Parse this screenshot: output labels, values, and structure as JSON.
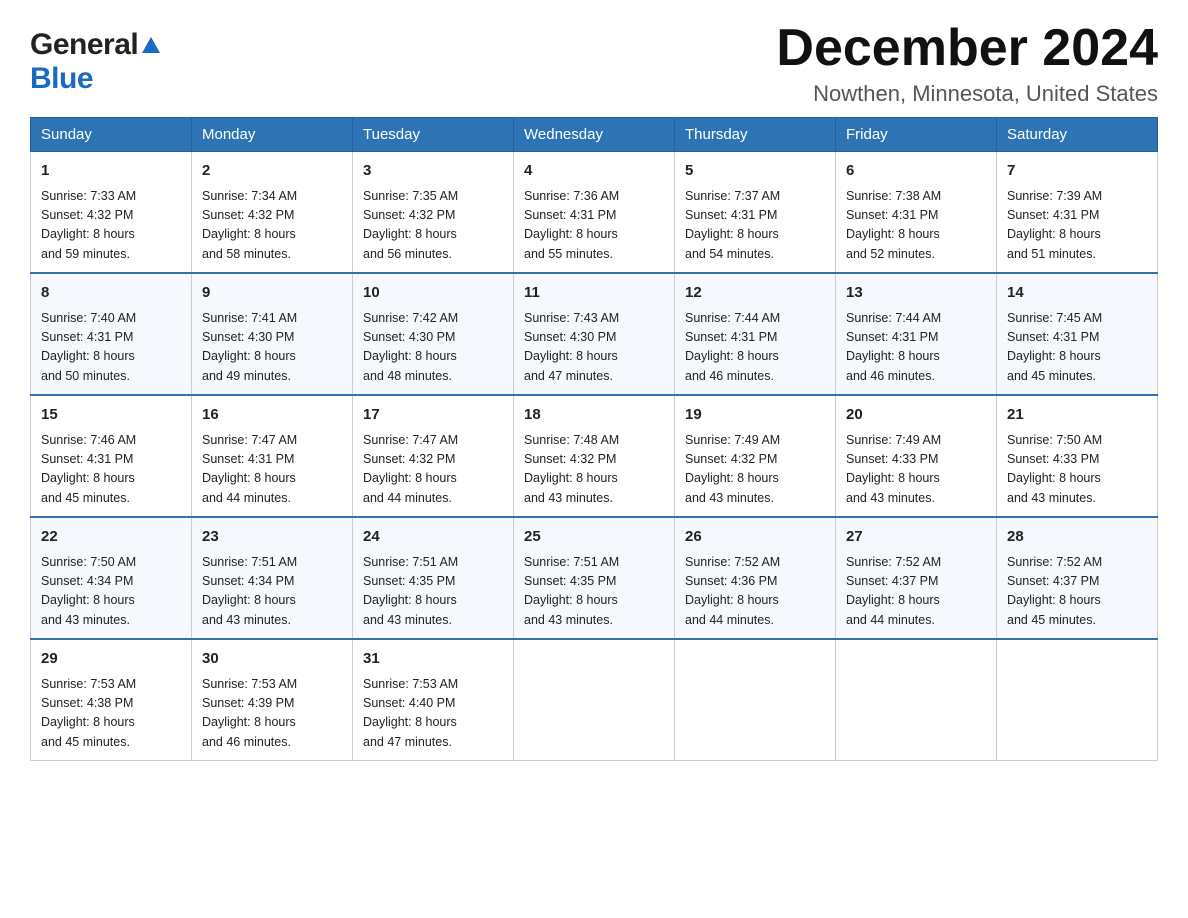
{
  "header": {
    "logo_general": "General",
    "logo_blue": "Blue",
    "month_title": "December 2024",
    "location": "Nowthen, Minnesota, United States"
  },
  "weekdays": [
    "Sunday",
    "Monday",
    "Tuesday",
    "Wednesday",
    "Thursday",
    "Friday",
    "Saturday"
  ],
  "weeks": [
    [
      {
        "day": "1",
        "sunrise": "7:33 AM",
        "sunset": "4:32 PM",
        "daylight": "8 hours and 59 minutes."
      },
      {
        "day": "2",
        "sunrise": "7:34 AM",
        "sunset": "4:32 PM",
        "daylight": "8 hours and 58 minutes."
      },
      {
        "day": "3",
        "sunrise": "7:35 AM",
        "sunset": "4:32 PM",
        "daylight": "8 hours and 56 minutes."
      },
      {
        "day": "4",
        "sunrise": "7:36 AM",
        "sunset": "4:31 PM",
        "daylight": "8 hours and 55 minutes."
      },
      {
        "day": "5",
        "sunrise": "7:37 AM",
        "sunset": "4:31 PM",
        "daylight": "8 hours and 54 minutes."
      },
      {
        "day": "6",
        "sunrise": "7:38 AM",
        "sunset": "4:31 PM",
        "daylight": "8 hours and 52 minutes."
      },
      {
        "day": "7",
        "sunrise": "7:39 AM",
        "sunset": "4:31 PM",
        "daylight": "8 hours and 51 minutes."
      }
    ],
    [
      {
        "day": "8",
        "sunrise": "7:40 AM",
        "sunset": "4:31 PM",
        "daylight": "8 hours and 50 minutes."
      },
      {
        "day": "9",
        "sunrise": "7:41 AM",
        "sunset": "4:30 PM",
        "daylight": "8 hours and 49 minutes."
      },
      {
        "day": "10",
        "sunrise": "7:42 AM",
        "sunset": "4:30 PM",
        "daylight": "8 hours and 48 minutes."
      },
      {
        "day": "11",
        "sunrise": "7:43 AM",
        "sunset": "4:30 PM",
        "daylight": "8 hours and 47 minutes."
      },
      {
        "day": "12",
        "sunrise": "7:44 AM",
        "sunset": "4:31 PM",
        "daylight": "8 hours and 46 minutes."
      },
      {
        "day": "13",
        "sunrise": "7:44 AM",
        "sunset": "4:31 PM",
        "daylight": "8 hours and 46 minutes."
      },
      {
        "day": "14",
        "sunrise": "7:45 AM",
        "sunset": "4:31 PM",
        "daylight": "8 hours and 45 minutes."
      }
    ],
    [
      {
        "day": "15",
        "sunrise": "7:46 AM",
        "sunset": "4:31 PM",
        "daylight": "8 hours and 45 minutes."
      },
      {
        "day": "16",
        "sunrise": "7:47 AM",
        "sunset": "4:31 PM",
        "daylight": "8 hours and 44 minutes."
      },
      {
        "day": "17",
        "sunrise": "7:47 AM",
        "sunset": "4:32 PM",
        "daylight": "8 hours and 44 minutes."
      },
      {
        "day": "18",
        "sunrise": "7:48 AM",
        "sunset": "4:32 PM",
        "daylight": "8 hours and 43 minutes."
      },
      {
        "day": "19",
        "sunrise": "7:49 AM",
        "sunset": "4:32 PM",
        "daylight": "8 hours and 43 minutes."
      },
      {
        "day": "20",
        "sunrise": "7:49 AM",
        "sunset": "4:33 PM",
        "daylight": "8 hours and 43 minutes."
      },
      {
        "day": "21",
        "sunrise": "7:50 AM",
        "sunset": "4:33 PM",
        "daylight": "8 hours and 43 minutes."
      }
    ],
    [
      {
        "day": "22",
        "sunrise": "7:50 AM",
        "sunset": "4:34 PM",
        "daylight": "8 hours and 43 minutes."
      },
      {
        "day": "23",
        "sunrise": "7:51 AM",
        "sunset": "4:34 PM",
        "daylight": "8 hours and 43 minutes."
      },
      {
        "day": "24",
        "sunrise": "7:51 AM",
        "sunset": "4:35 PM",
        "daylight": "8 hours and 43 minutes."
      },
      {
        "day": "25",
        "sunrise": "7:51 AM",
        "sunset": "4:35 PM",
        "daylight": "8 hours and 43 minutes."
      },
      {
        "day": "26",
        "sunrise": "7:52 AM",
        "sunset": "4:36 PM",
        "daylight": "8 hours and 44 minutes."
      },
      {
        "day": "27",
        "sunrise": "7:52 AM",
        "sunset": "4:37 PM",
        "daylight": "8 hours and 44 minutes."
      },
      {
        "day": "28",
        "sunrise": "7:52 AM",
        "sunset": "4:37 PM",
        "daylight": "8 hours and 45 minutes."
      }
    ],
    [
      {
        "day": "29",
        "sunrise": "7:53 AM",
        "sunset": "4:38 PM",
        "daylight": "8 hours and 45 minutes."
      },
      {
        "day": "30",
        "sunrise": "7:53 AM",
        "sunset": "4:39 PM",
        "daylight": "8 hours and 46 minutes."
      },
      {
        "day": "31",
        "sunrise": "7:53 AM",
        "sunset": "4:40 PM",
        "daylight": "8 hours and 47 minutes."
      },
      null,
      null,
      null,
      null
    ]
  ],
  "labels": {
    "sunrise": "Sunrise:",
    "sunset": "Sunset:",
    "daylight": "Daylight:"
  }
}
